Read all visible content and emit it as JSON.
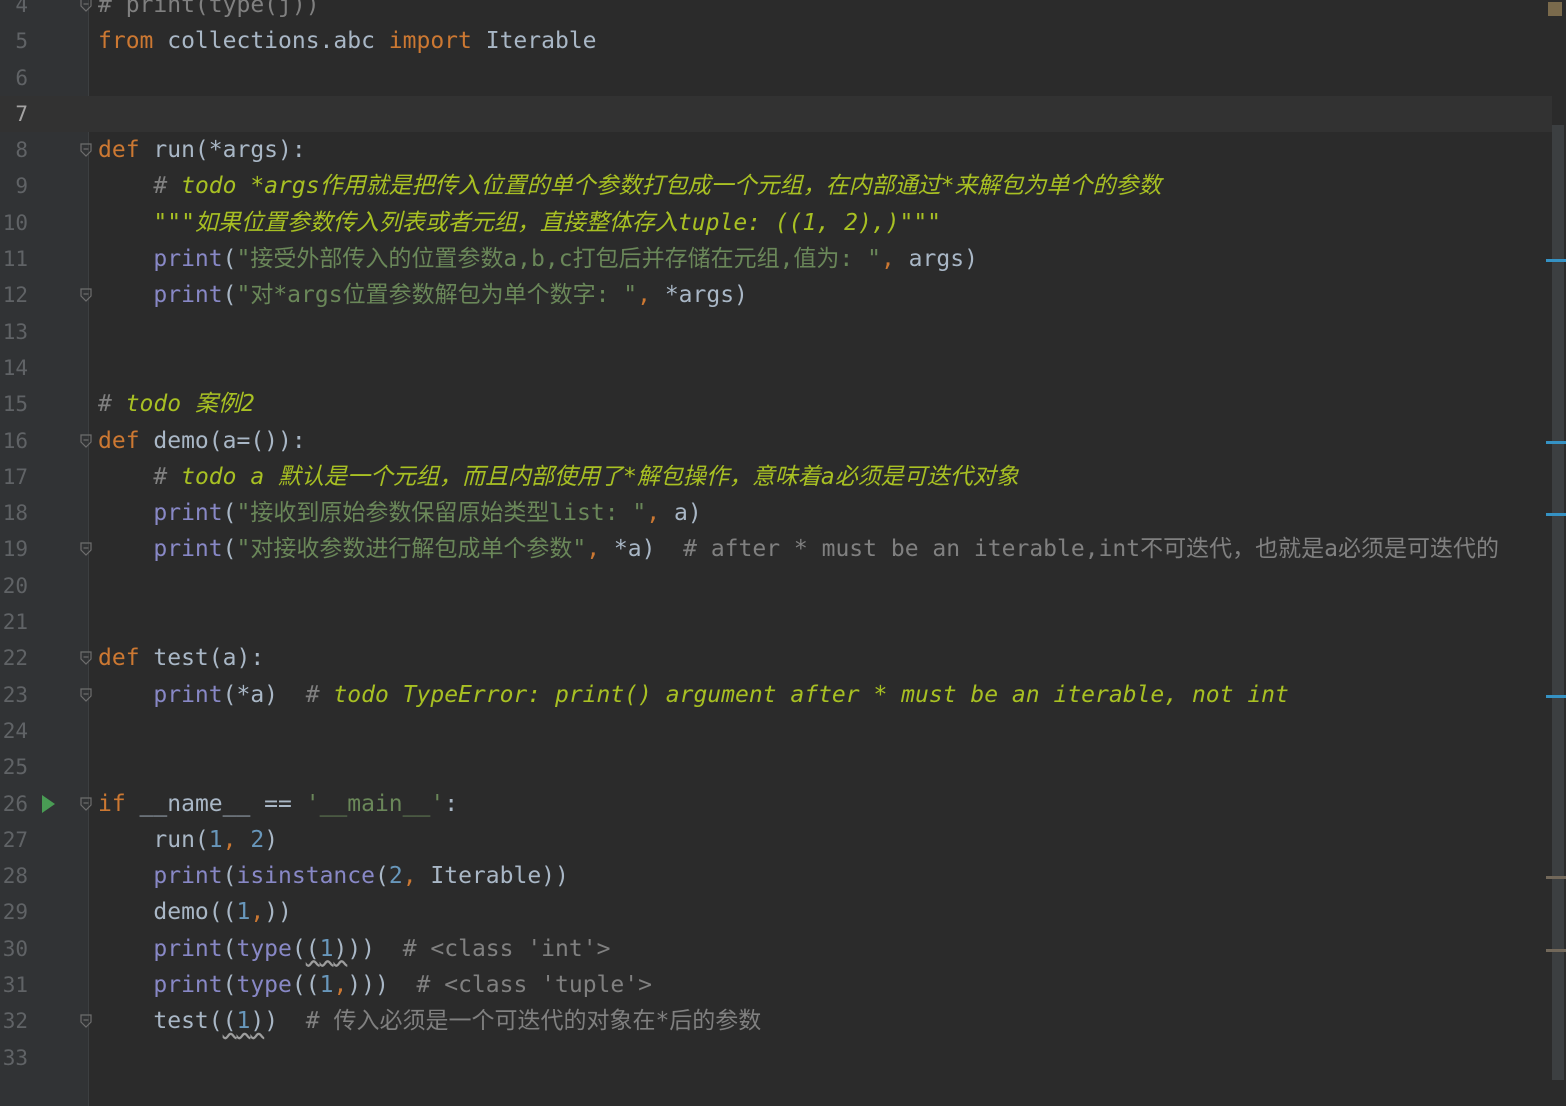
{
  "editor": {
    "current_line": 7,
    "lines": [
      {
        "n": "4",
        "segments": [
          {
            "c": "cmt",
            "t": "# print(type(j))"
          }
        ]
      },
      {
        "n": "5",
        "segments": [
          {
            "c": "kw",
            "t": "from"
          },
          {
            "c": "",
            "t": " collections.abc "
          },
          {
            "c": "kw",
            "t": "import"
          },
          {
            "c": "",
            "t": " Iterable"
          }
        ]
      },
      {
        "n": "6",
        "segments": []
      },
      {
        "n": "7",
        "segments": []
      },
      {
        "n": "8",
        "segments": [
          {
            "c": "kw",
            "t": "def"
          },
          {
            "c": "",
            "t": " run(*args):"
          }
        ]
      },
      {
        "n": "9",
        "segments": [
          {
            "c": "cmt",
            "t": "    # "
          },
          {
            "c": "todo",
            "t": "todo *args作用就是把传入位置的单个参数打包成一个元组，在内部通过*来解包为单个的参数"
          }
        ]
      },
      {
        "n": "10",
        "segments": [
          {
            "c": "todo",
            "t": "    \"\"\"如果位置参数传入列表或者元组，直接整体存入tuple: ((1, 2),)\"\"\""
          }
        ]
      },
      {
        "n": "11",
        "segments": [
          {
            "c": "bi",
            "t": "    print"
          },
          {
            "c": "",
            "t": "("
          },
          {
            "c": "str",
            "t": "\"接受外部传入的位置参数a,b,c打包后并存储在元组,值为: \""
          },
          {
            "c": "kw",
            "t": ","
          },
          {
            "c": "",
            "t": " args)"
          }
        ]
      },
      {
        "n": "12",
        "segments": [
          {
            "c": "bi",
            "t": "    print"
          },
          {
            "c": "",
            "t": "("
          },
          {
            "c": "str",
            "t": "\"对*args位置参数解包为单个数字: \""
          },
          {
            "c": "kw",
            "t": ","
          },
          {
            "c": "",
            "t": " *args)"
          }
        ]
      },
      {
        "n": "13",
        "segments": []
      },
      {
        "n": "14",
        "segments": []
      },
      {
        "n": "15",
        "segments": [
          {
            "c": "cmt",
            "t": "# "
          },
          {
            "c": "todo",
            "t": "todo 案例2"
          }
        ]
      },
      {
        "n": "16",
        "segments": [
          {
            "c": "kw",
            "t": "def"
          },
          {
            "c": "",
            "t": " demo(a=()):"
          }
        ]
      },
      {
        "n": "17",
        "segments": [
          {
            "c": "cmt",
            "t": "    # "
          },
          {
            "c": "todo",
            "t": "todo a 默认是一个元组，而且内部使用了*解包操作，意味着a必须是可迭代对象"
          }
        ]
      },
      {
        "n": "18",
        "segments": [
          {
            "c": "bi",
            "t": "    print"
          },
          {
            "c": "",
            "t": "("
          },
          {
            "c": "str",
            "t": "\"接收到原始参数保留原始类型list: \""
          },
          {
            "c": "kw",
            "t": ","
          },
          {
            "c": "",
            "t": " a)"
          }
        ]
      },
      {
        "n": "19",
        "segments": [
          {
            "c": "bi",
            "t": "    print"
          },
          {
            "c": "",
            "t": "("
          },
          {
            "c": "str",
            "t": "\"对接收参数进行解包成单个参数\""
          },
          {
            "c": "kw",
            "t": ","
          },
          {
            "c": "",
            "t": " *a)  "
          },
          {
            "c": "cmt",
            "t": "# after * must be an iterable,int不可迭代，也就是a必须是可迭代的"
          }
        ]
      },
      {
        "n": "20",
        "segments": []
      },
      {
        "n": "21",
        "segments": []
      },
      {
        "n": "22",
        "segments": [
          {
            "c": "kw",
            "t": "def"
          },
          {
            "c": "",
            "t": " test(a):"
          }
        ]
      },
      {
        "n": "23",
        "segments": [
          {
            "c": "bi",
            "t": "    print"
          },
          {
            "c": "",
            "t": "(*a)  "
          },
          {
            "c": "cmt",
            "t": "# "
          },
          {
            "c": "todo",
            "t": "todo TypeError: print() argument after * must be an iterable, not int"
          }
        ]
      },
      {
        "n": "24",
        "segments": []
      },
      {
        "n": "25",
        "segments": []
      },
      {
        "n": "26",
        "segments": [
          {
            "c": "kw",
            "t": "if"
          },
          {
            "c": "",
            "t": " __name__ == "
          },
          {
            "c": "str",
            "t": "'__main__'"
          },
          {
            "c": "",
            "t": ":"
          }
        ]
      },
      {
        "n": "27",
        "segments": [
          {
            "c": "",
            "t": "    run("
          },
          {
            "c": "num",
            "t": "1"
          },
          {
            "c": "kw",
            "t": ","
          },
          {
            "c": "num",
            "t": " 2"
          },
          {
            "c": "",
            "t": ")"
          }
        ]
      },
      {
        "n": "28",
        "segments": [
          {
            "c": "bi",
            "t": "    print"
          },
          {
            "c": "",
            "t": "("
          },
          {
            "c": "bi",
            "t": "isinstance"
          },
          {
            "c": "",
            "t": "("
          },
          {
            "c": "num",
            "t": "2"
          },
          {
            "c": "kw",
            "t": ","
          },
          {
            "c": "",
            "t": " Iterable))"
          }
        ]
      },
      {
        "n": "29",
        "segments": [
          {
            "c": "",
            "t": "    demo(("
          },
          {
            "c": "num",
            "t": "1"
          },
          {
            "c": "kw",
            "t": ","
          },
          {
            "c": "",
            "t": "))"
          }
        ]
      },
      {
        "n": "30",
        "segments": [
          {
            "c": "bi",
            "t": "    print"
          },
          {
            "c": "",
            "t": "("
          },
          {
            "c": "bi",
            "t": "type"
          },
          {
            "c": "",
            "t": "("
          },
          {
            "c": "wave",
            "t": "("
          },
          {
            "c": "num wave",
            "t": "1"
          },
          {
            "c": "wave",
            "t": ")"
          },
          {
            "c": "",
            "t": "))  "
          },
          {
            "c": "cmt",
            "t": "# <class 'int'>"
          }
        ]
      },
      {
        "n": "31",
        "segments": [
          {
            "c": "bi",
            "t": "    print"
          },
          {
            "c": "",
            "t": "("
          },
          {
            "c": "bi",
            "t": "type"
          },
          {
            "c": "",
            "t": "(("
          },
          {
            "c": "num",
            "t": "1"
          },
          {
            "c": "kw",
            "t": ","
          },
          {
            "c": "",
            "t": ")))  "
          },
          {
            "c": "cmt",
            "t": "# <class 'tuple'>"
          }
        ]
      },
      {
        "n": "32",
        "segments": [
          {
            "c": "",
            "t": "    test("
          },
          {
            "c": "wave",
            "t": "("
          },
          {
            "c": "num wave",
            "t": "1"
          },
          {
            "c": "wave",
            "t": ")"
          },
          {
            "c": "",
            "t": ")  "
          },
          {
            "c": "cmt",
            "t": "# 传入必须是一个可迭代的对象在*后的参数"
          }
        ]
      },
      {
        "n": "33",
        "segments": []
      }
    ]
  },
  "gutter": {
    "fold_lines": [
      "4",
      "8",
      "12",
      "16",
      "19",
      "22",
      "23",
      "26",
      "32"
    ],
    "run_line": "26"
  },
  "scrollbar": {
    "marks": [
      {
        "line": "11",
        "color": "#3592c4"
      },
      {
        "line": "16",
        "color": "#3592c4"
      },
      {
        "line": "18",
        "color": "#3592c4"
      },
      {
        "line": "23",
        "color": "#3592c4"
      },
      {
        "line": "28",
        "color": "#72685a"
      },
      {
        "line": "30",
        "color": "#72685a"
      }
    ]
  }
}
